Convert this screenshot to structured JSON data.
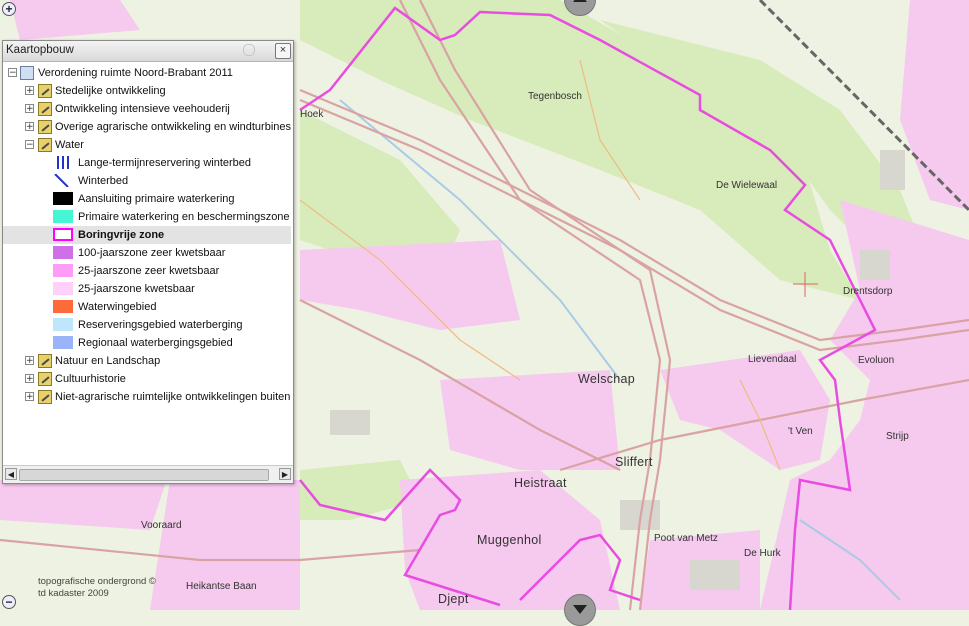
{
  "panel": {
    "title": "Kaartopbouw",
    "close_label": "×",
    "root_label": "Verordening ruimte Noord-Brabant 2011",
    "groups_top": [
      {
        "label": "Stedelijke ontwikkeling",
        "toggle": "+"
      },
      {
        "label": "Ontwikkeling intensieve veehouderij",
        "toggle": "+"
      },
      {
        "label": "Overige agrarische ontwikkeling en windturbines",
        "toggle": "+"
      },
      {
        "label": "Water",
        "toggle": "−"
      }
    ],
    "water_legend": [
      {
        "label": "Lange-termijnreservering winterbed",
        "icon": "blue-vertical-lines"
      },
      {
        "label": "Winterbed",
        "icon": "blue-diagonal-lines"
      },
      {
        "label": "Aansluiting primaire waterkering",
        "color": "#000000"
      },
      {
        "label": "Primaire waterkering en beschermingszone",
        "color": "#46f5d2"
      },
      {
        "label": "Boringvrije zone",
        "color": "#ff00ff",
        "style": "outline",
        "selected": true
      },
      {
        "label": "100-jaarszone zeer kwetsbaar",
        "color": "#d070e8"
      },
      {
        "label": "25-jaarszone zeer kwetsbaar",
        "color": "#ff9cf5"
      },
      {
        "label": "25-jaarszone kwetsbaar",
        "color": "#ffd0f8"
      },
      {
        "label": "Waterwingebied",
        "color": "#ff6a3a"
      },
      {
        "label": "Reserveringsgebied waterberging",
        "color": "#bfe6fa"
      },
      {
        "label": "Regionaal waterbergingsgebied",
        "color": "#9ab4fa"
      }
    ],
    "groups_bottom": [
      {
        "label": "Natuur en Landschap",
        "toggle": "+"
      },
      {
        "label": "Cultuurhistorie",
        "toggle": "+"
      },
      {
        "label": "Niet-agrarische ruimtelijke ontwikkelingen buiten b",
        "toggle": "+"
      }
    ]
  },
  "map": {
    "zoom_in": "+",
    "zoom_out": "−",
    "place_labels": [
      {
        "text": "Hoek"
      },
      {
        "text": "Tegenbosch"
      },
      {
        "text": "De Wielewaal"
      },
      {
        "text": "Drentsdorp"
      },
      {
        "text": "Lievendaal"
      },
      {
        "text": "Evoluon"
      },
      {
        "text": "Welschap"
      },
      {
        "text": "'t Ven"
      },
      {
        "text": "Strijp"
      },
      {
        "text": "Sliffert"
      },
      {
        "text": "Heistraat"
      },
      {
        "text": "Muggenhol"
      },
      {
        "text": "Poot van Metz"
      },
      {
        "text": "De Hurk"
      },
      {
        "text": "Vooraard"
      },
      {
        "text": "Heikantse Baan"
      },
      {
        "text": "Djept"
      }
    ],
    "attribution": [
      "topografische ondergrond ©",
      "td kadaster 2009"
    ],
    "colors": {
      "boundary": "#e84ce0",
      "urban": "#f5c9ef",
      "green": "#d9ebbb",
      "road": "#d9a3a3"
    }
  }
}
